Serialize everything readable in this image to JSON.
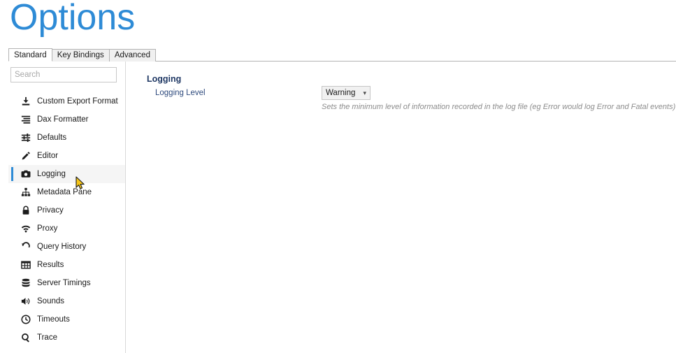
{
  "window": {
    "title": "Options"
  },
  "tabs": [
    {
      "label": "Standard",
      "selected": true
    },
    {
      "label": "Key Bindings",
      "selected": false
    },
    {
      "label": "Advanced",
      "selected": false
    }
  ],
  "sidebar": {
    "search": {
      "value": "",
      "placeholder": "Search"
    },
    "items": [
      {
        "label": "Custom Export Format",
        "icon": "export-icon",
        "active": false
      },
      {
        "label": "Dax Formatter",
        "icon": "format-lines-icon",
        "active": false
      },
      {
        "label": "Defaults",
        "icon": "sliders-icon",
        "active": false
      },
      {
        "label": "Editor",
        "icon": "pencil-icon",
        "active": false
      },
      {
        "label": "Logging",
        "icon": "camera-icon",
        "active": true
      },
      {
        "label": "Metadata Pane",
        "icon": "hierarchy-icon",
        "active": false
      },
      {
        "label": "Privacy",
        "icon": "lock-icon",
        "active": false
      },
      {
        "label": "Proxy",
        "icon": "wifi-icon",
        "active": false
      },
      {
        "label": "Query History",
        "icon": "history-icon",
        "active": false
      },
      {
        "label": "Results",
        "icon": "grid-icon",
        "active": false
      },
      {
        "label": "Server Timings",
        "icon": "database-icon",
        "active": false
      },
      {
        "label": "Sounds",
        "icon": "speaker-icon",
        "active": false
      },
      {
        "label": "Timeouts",
        "icon": "clock-icon",
        "active": false
      },
      {
        "label": "Trace",
        "icon": "magnifier-icon",
        "active": false
      }
    ]
  },
  "content": {
    "section_title": "Logging",
    "field_label": "Logging Level",
    "logging_level": {
      "value": "Warning",
      "options": [
        "Warning"
      ]
    },
    "help_text": "Sets the minimum level of information recorded in the log file (eg Error would log Error and Fatal events)"
  },
  "colors": {
    "title_blue": "#2E8BD6",
    "heading_navy": "#1F3864",
    "accent_bar": "#2E8BD6",
    "selection_bg": "#f5f5f5",
    "help_gray": "#8c8c8c"
  }
}
